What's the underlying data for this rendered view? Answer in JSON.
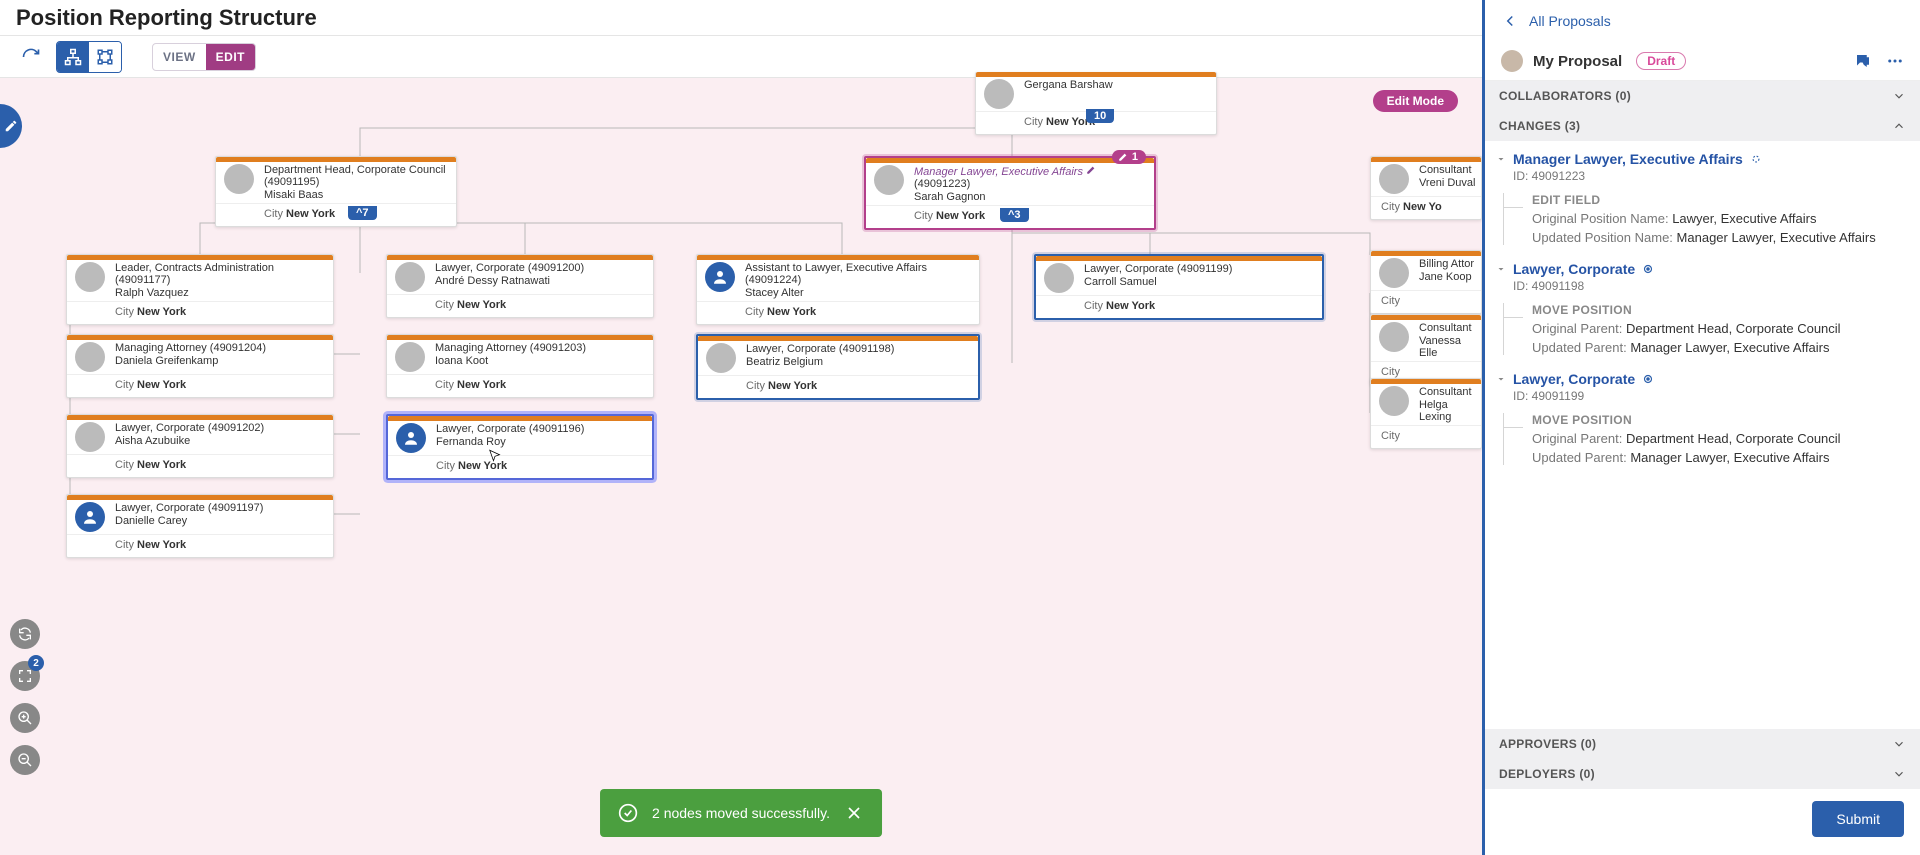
{
  "header": {
    "title": "Position Reporting Structure"
  },
  "toolbar": {
    "view": "VIEW",
    "edit": "EDIT"
  },
  "badge": {
    "edit_mode": "Edit Mode"
  },
  "nodes": {
    "gergana": {
      "title": "Gergana Barshaw",
      "person": "",
      "cityKey": "City",
      "city": "New York"
    },
    "misaki": {
      "title": "Department Head, Corporate Council (49091195)",
      "person": "Misaki Baas",
      "cityKey": "City",
      "city": "New York"
    },
    "sarah": {
      "title": "Manager Lawyer, Executive Affairs",
      "id": "(49091223)",
      "person": "Sarah Gagnon",
      "cityKey": "City",
      "city": "New York"
    },
    "ralph": {
      "title": "Leader, Contracts Administration (49091177)",
      "person": "Ralph Vazquez",
      "cityKey": "City",
      "city": "New York"
    },
    "andre": {
      "title": "Lawyer, Corporate (49091200)",
      "person": "André Dessy Ratnawati",
      "cityKey": "City",
      "city": "New York"
    },
    "stacey": {
      "title": "Assistant to Lawyer, Executive Affairs (49091224)",
      "person": "Stacey Alter",
      "cityKey": "City",
      "city": "New York"
    },
    "carroll": {
      "title": "Lawyer, Corporate (49091199)",
      "person": "Carroll Samuel",
      "cityKey": "City",
      "city": "New York"
    },
    "daniela": {
      "title": "Managing Attorney (49091204)",
      "person": "Daniela Greifenkamp",
      "cityKey": "City",
      "city": "New York"
    },
    "ioana": {
      "title": "Managing Attorney (49091203)",
      "person": "Ioana Koot",
      "cityKey": "City",
      "city": "New York"
    },
    "beatriz": {
      "title": "Lawyer, Corporate (49091198)",
      "person": "Beatriz Belgium",
      "cityKey": "City",
      "city": "New York"
    },
    "aisha": {
      "title": "Lawyer, Corporate (49091202)",
      "person": "Aisha Azubuike",
      "cityKey": "City",
      "city": "New York"
    },
    "fernanda": {
      "title": "Lawyer, Corporate (49091196)",
      "person": "Fernanda Roy",
      "cityKey": "City",
      "city": "New York"
    },
    "danielle": {
      "title": "Lawyer, Corporate (49091197)",
      "person": "Danielle Carey",
      "cityKey": "City",
      "city": "New York"
    },
    "vreni": {
      "title": "Consultant",
      "person": "Vreni Duval",
      "cityKey": "City",
      "city": "New Yo"
    },
    "jane": {
      "title": "Billing Attor",
      "person": "Jane Koop",
      "cityKey": "City",
      "city": ""
    },
    "vanessa": {
      "title": "Consultant",
      "person": "Vanessa Elle",
      "cityKey": "City",
      "city": ""
    },
    "helga": {
      "title": "Consultant",
      "person": "Helga Lexing",
      "cityKey": "City",
      "city": ""
    }
  },
  "counts": {
    "gergana": "10",
    "misaki": "^7",
    "sarah": "^3",
    "sarah_pill": "1"
  },
  "toast": {
    "text": "2 nodes moved successfully."
  },
  "fab_badge": "2",
  "panel": {
    "back": "All Proposals",
    "prop_name": "My Proposal",
    "draft": "Draft",
    "collab": "COLLABORATORS (0)",
    "changes": "CHANGES (3)",
    "approvers": "APPROVERS (0)",
    "deployers": "DEPLOYERS (0)",
    "submit": "Submit",
    "c1": {
      "title": "Manager Lawyer, Executive Affairs",
      "id": "ID: 49091223",
      "label": "EDIT FIELD",
      "l1k": "Original Position Name:",
      "l1v": "Lawyer, Executive Affairs",
      "l2k": "Updated Position Name:",
      "l2v": "Manager Lawyer, Executive Affairs"
    },
    "c2": {
      "title": "Lawyer, Corporate",
      "id": "ID: 49091198",
      "label": "MOVE POSITION",
      "l1k": "Original Parent:",
      "l1v": "Department Head, Corporate Council",
      "l2k": "Updated Parent:",
      "l2v": "Manager Lawyer, Executive Affairs"
    },
    "c3": {
      "title": "Lawyer, Corporate",
      "id": "ID: 49091199",
      "label": "MOVE POSITION",
      "l1k": "Original Parent:",
      "l1v": "Department Head, Corporate Council",
      "l2k": "Updated Parent:",
      "l2v": "Manager Lawyer, Executive Affairs"
    }
  }
}
